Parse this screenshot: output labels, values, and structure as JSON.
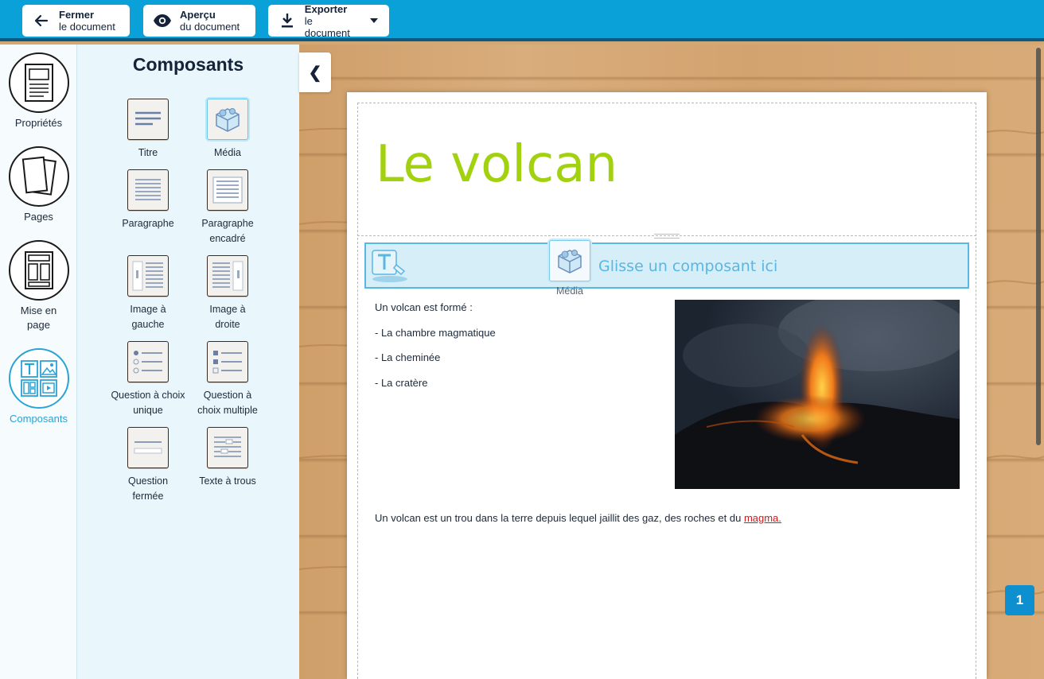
{
  "toolbar": {
    "close": {
      "line1": "Fermer",
      "line2": "le document",
      "icon": "arrow-left-icon"
    },
    "preview": {
      "line1": "Aperçu",
      "line2": "du document",
      "icon": "eye-icon"
    },
    "export": {
      "line1": "Exporter",
      "line2": "le document",
      "icon": "download-icon"
    }
  },
  "nav": {
    "properties": "Propriétés",
    "pages": "Pages",
    "layout": "Mise en page",
    "components": "Composants"
  },
  "panel": {
    "title": "Composants",
    "items": [
      {
        "label": "Titre",
        "icon": "title-icon"
      },
      {
        "label": "Média",
        "icon": "media-icon"
      },
      {
        "label": "Paragraphe",
        "icon": "paragraph-icon"
      },
      {
        "label": "Paragraphe encadré",
        "icon": "framed-paragraph-icon"
      },
      {
        "label": "Image à gauche",
        "icon": "image-left-icon"
      },
      {
        "label": "Image à droite",
        "icon": "image-right-icon"
      },
      {
        "label": "Question à choix unique",
        "icon": "single-choice-icon"
      },
      {
        "label": "Question à choix multiple",
        "icon": "multiple-choice-icon"
      },
      {
        "label": "Question fermée",
        "icon": "closed-question-icon"
      },
      {
        "label": "Texte à trous",
        "icon": "fill-in-blanks-icon"
      }
    ]
  },
  "collapse": "❮",
  "document": {
    "title": "Le volcan",
    "drop_hint": "Glisse un composant ici",
    "drag_label": "Média",
    "list_intro": "Un volcan est formé :",
    "list_items": [
      "- La chambre magmatique",
      "- La cheminée",
      "- La cratère"
    ],
    "paragraph_prefix": "Un volcan est un trou dans la terre depuis lequel jaillit des gaz, des roches et du ",
    "paragraph_link": "magma."
  },
  "page_number": "1",
  "colors": {
    "topbar": "#0aa0d8",
    "title_green": "#a2d20f",
    "accent_blue": "#2aa3d6",
    "link_red": "#d3171a"
  }
}
